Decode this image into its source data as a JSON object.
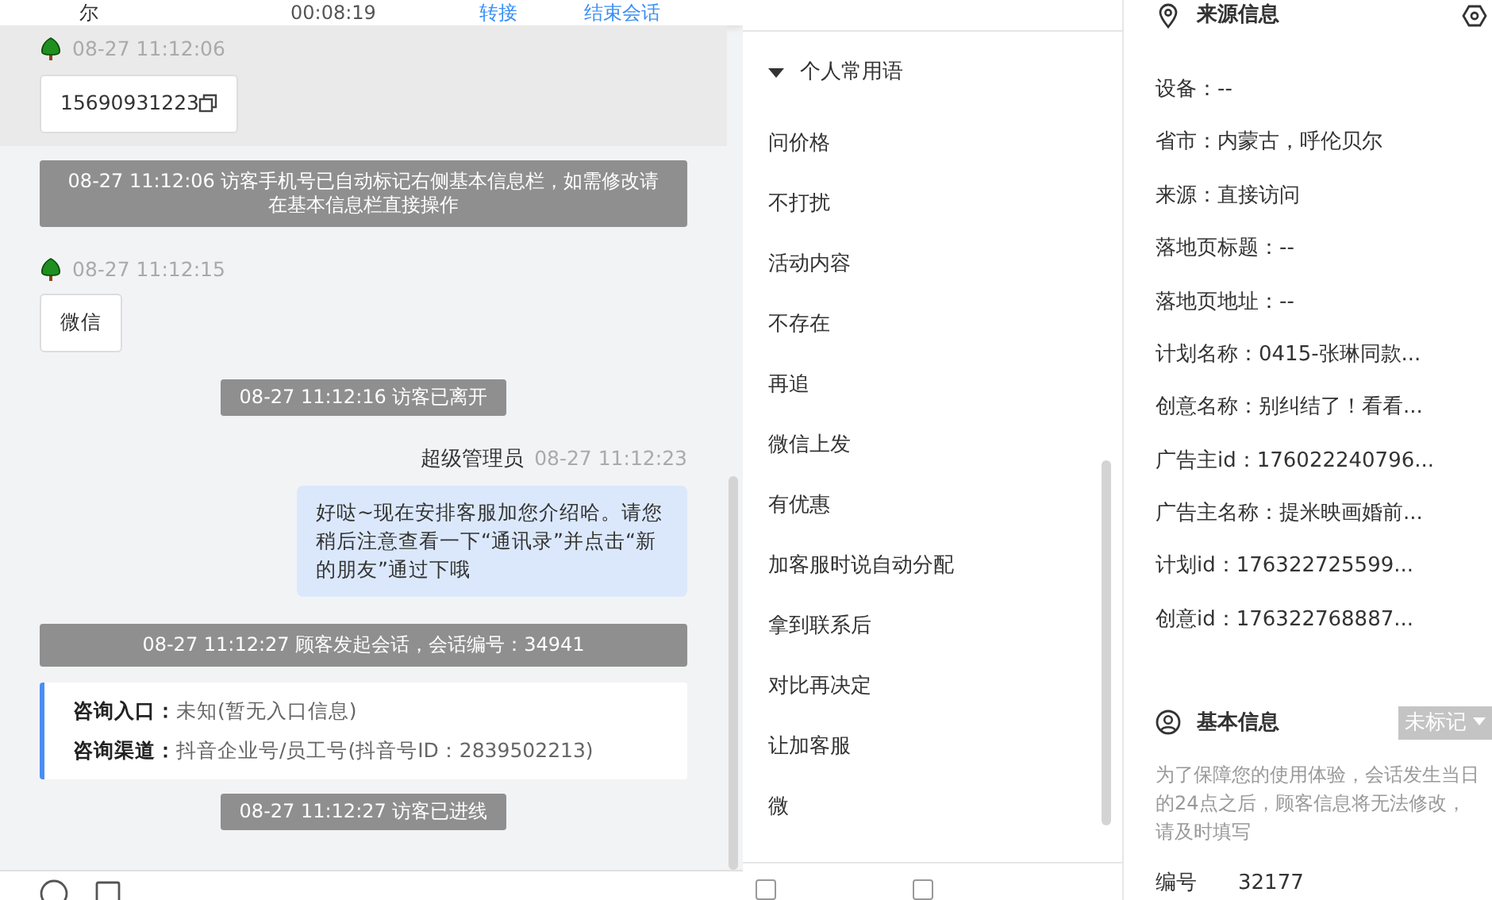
{
  "chat_header": {
    "visitor": "尔",
    "duration": "00:08:19",
    "actions": [
      "转接",
      "结束会话"
    ]
  },
  "messages": [
    {
      "kind": "visitor",
      "time": "08-27 11:12:06",
      "text": "15690931223",
      "copyable": true,
      "highlighted": true
    },
    {
      "kind": "notice",
      "text": "08-27 11:12:06 访客手机号已自动标记右侧基本信息栏，如需修改请在基本信息栏直接操作"
    },
    {
      "kind": "visitor",
      "time": "08-27 11:12:15",
      "text": "微信"
    },
    {
      "kind": "notice",
      "text": "08-27 11:12:16 访客已离开"
    },
    {
      "kind": "agent",
      "name": "超级管理员",
      "time": "08-27 11:12:23",
      "text": "好哒~现在安排客服加您介绍哈。请您稍后注意查看一下“通讯录”并点击“新的朋友”通过下哦"
    },
    {
      "kind": "notice",
      "text": "08-27 11:12:27 顾客发起会话，会话编号：34941"
    },
    {
      "kind": "info",
      "rows": [
        {
          "label": "咨询入口：",
          "value": "未知(暂无入口信息)"
        },
        {
          "label": "咨询渠道：",
          "value": "抖音企业号/员工号(抖音号ID：2839502213)"
        }
      ]
    },
    {
      "kind": "notice",
      "text": "08-27 11:12:27 访客已进线"
    }
  ],
  "phrases": {
    "group": "个人常用语",
    "expanded": true,
    "items": [
      "问价格",
      "不打扰",
      "活动内容",
      "不存在",
      "再追",
      "微信上发",
      "有优惠",
      "加客服时说自动分配",
      "拿到联系后",
      "对比再决定",
      "让加客服",
      "微"
    ]
  },
  "phrase_options": [
    {
      "checked": false
    },
    {
      "checked": false
    }
  ],
  "source_info": {
    "title": "来源信息",
    "rows": [
      "设备：--",
      "省市：内蒙古，呼伦贝尔",
      "来源：直接访问",
      "落地页标题：--",
      "落地页地址：--",
      "计划名称：0415-张琳同款...",
      "创意名称：别纠结了！看看...",
      "广告主id：176022240796...",
      "广告主名称：提米映画婚前...",
      "计划id：176322725599...",
      "创意id：176322768887..."
    ]
  },
  "basic_info": {
    "title": "基本信息",
    "tag": "未标记",
    "note": "为了保障您的使用体验，会话发生当日的24点之后，顾客信息将无法修改，请及时填写",
    "fields": [
      {
        "label": "编号",
        "value": "32177"
      }
    ]
  }
}
